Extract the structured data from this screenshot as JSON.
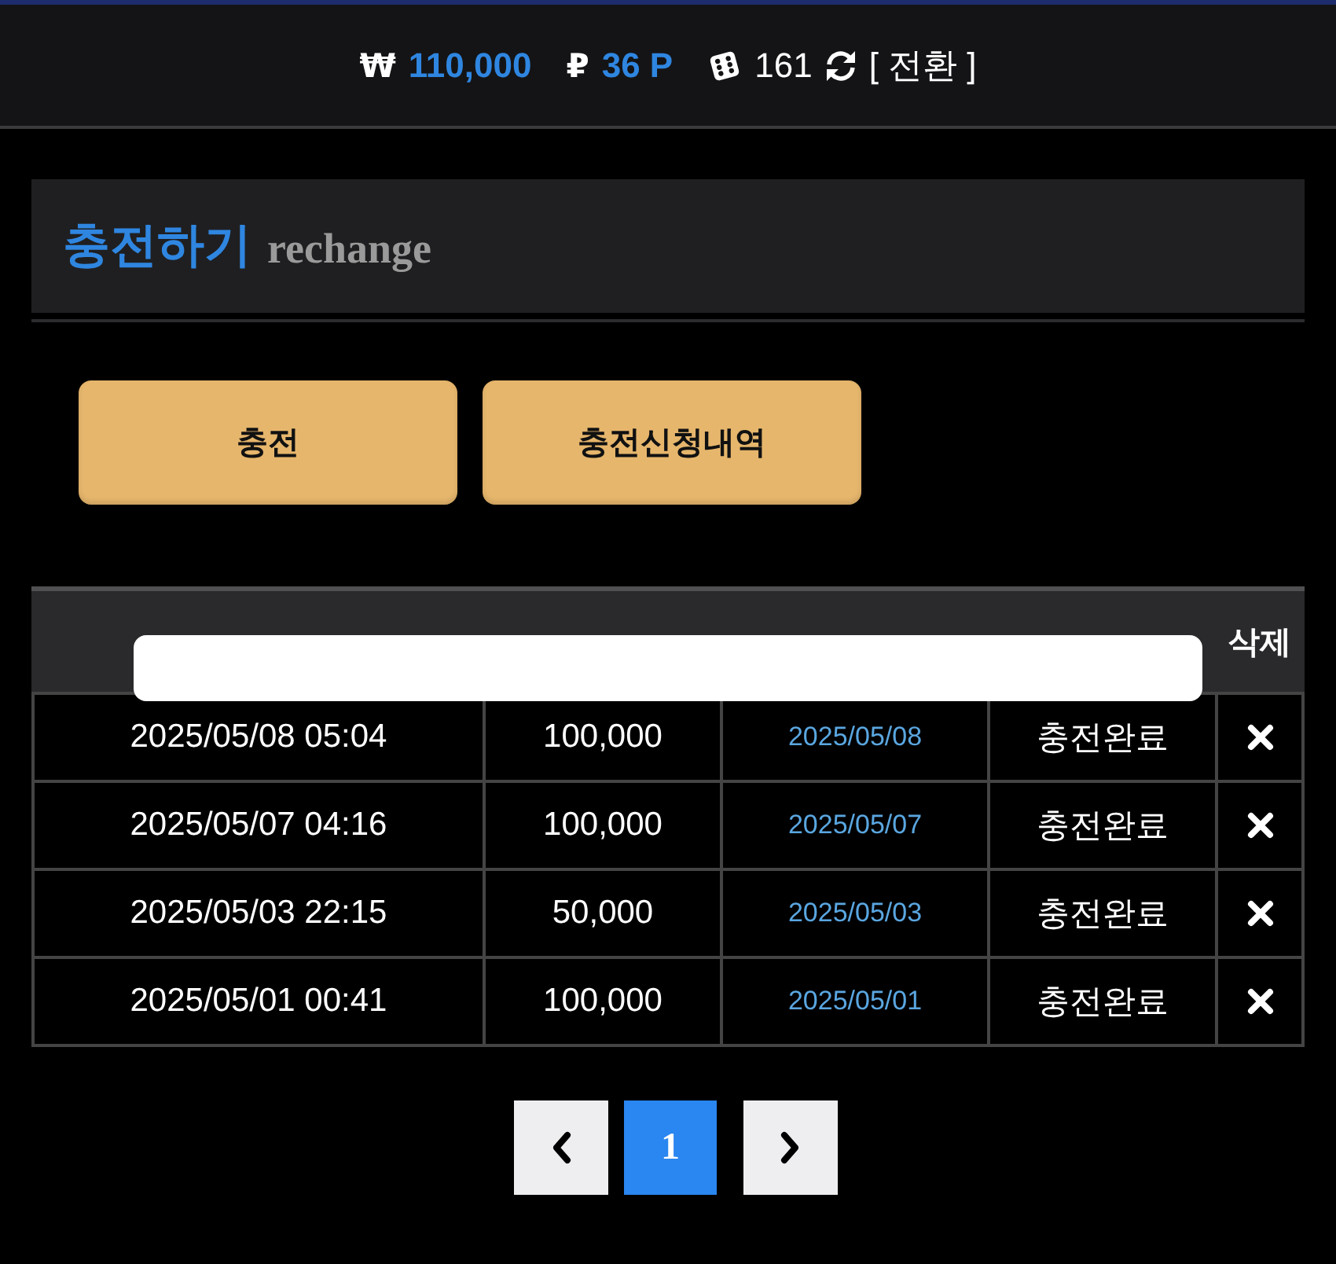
{
  "top_bar": {
    "balances": [
      {
        "kind": "currency",
        "symbol": "₩",
        "value": "110,000"
      },
      {
        "kind": "currency",
        "symbol": "₽",
        "value": "36 P"
      },
      {
        "kind": "dice",
        "value": "161"
      }
    ],
    "switch_label": "[ 전환 ]"
  },
  "section": {
    "title": "충전하기",
    "subtitle": "rechange"
  },
  "buttons": [
    {
      "label": "충전"
    },
    {
      "label": "충전신청내역"
    }
  ],
  "table": {
    "columns": [
      {
        "kind": "covered"
      },
      {
        "kind": "covered"
      },
      {
        "kind": "covered"
      },
      {
        "kind": "covered"
      },
      {
        "kind": "label",
        "label": "삭제"
      }
    ],
    "rows": [
      {
        "request_time": "2025/05/08 05:04",
        "amount": "100,000",
        "charge_date": "2025/05/08",
        "status": "충전완료"
      },
      {
        "request_time": "2025/05/07 04:16",
        "amount": "100,000",
        "charge_date": "2025/05/07",
        "status": "충전완료"
      },
      {
        "request_time": "2025/05/03 22:15",
        "amount": "50,000",
        "charge_date": "2025/05/03",
        "status": "충전완료"
      },
      {
        "request_time": "2025/05/01 00:41",
        "amount": "100,000",
        "charge_date": "2025/05/01",
        "status": "충전완료"
      }
    ]
  },
  "pagination": {
    "pages": [
      {
        "label": "1",
        "selected": true
      }
    ]
  }
}
